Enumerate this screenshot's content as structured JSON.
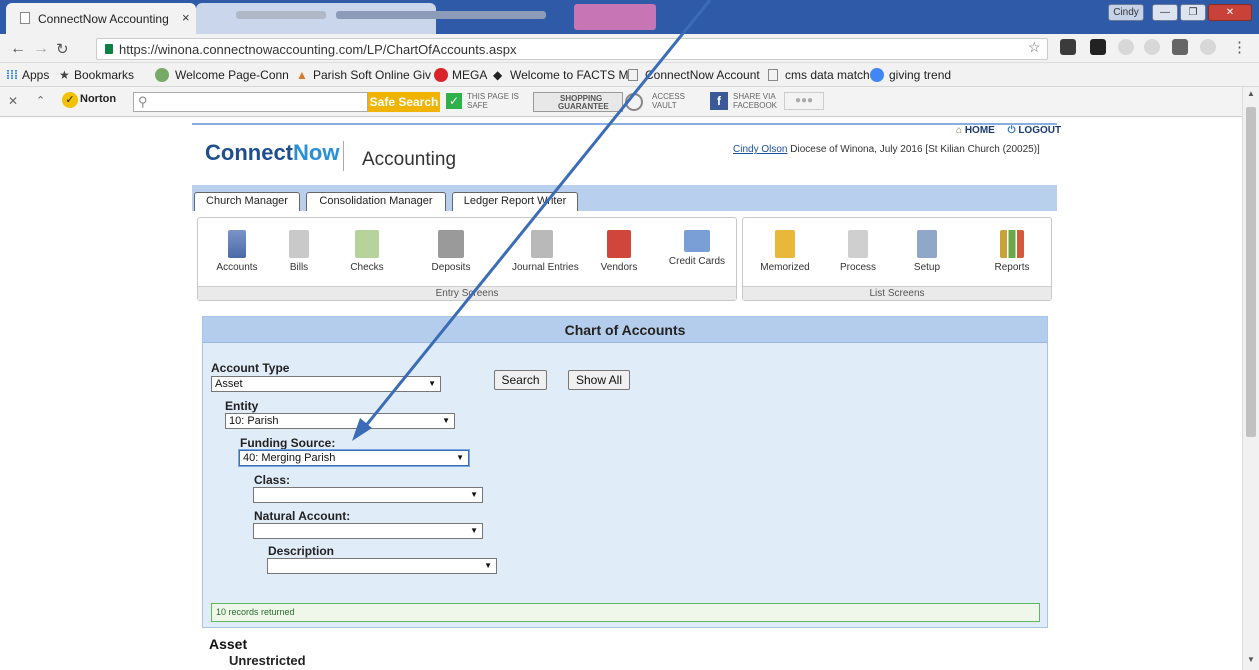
{
  "browser": {
    "tabs": [
      {
        "title": "ConnectNow Accounting"
      }
    ],
    "tab_close": "×",
    "window_user": "Cindy",
    "url": "https://winona.connectnowaccounting.com/LP/ChartOfAccounts.aspx",
    "bookmarks": [
      "Apps",
      "Bookmarks",
      "Welcome Page-Conn",
      "Parish Soft Online Giv",
      "MEGA",
      "Welcome to FACTS M",
      "ConnectNow Account",
      "cms data match",
      "giving trend"
    ],
    "norton": {
      "logo": "Norton",
      "safe_search": "Safe Search",
      "page_safe_line1": "THIS PAGE IS",
      "page_safe_line2": "SAFE",
      "shopping_line1": "SHOPPING",
      "shopping_line2": "GUARANTEE",
      "vault_line1": "ACCESS",
      "vault_line2": "VAULT",
      "share_line1": "SHARE VIA",
      "share_line2": "FACEBOOK"
    }
  },
  "app": {
    "logo_part1": "Connect",
    "logo_part2": "Now",
    "title": "Accounting",
    "home": "HOME",
    "logout": "LOGOUT",
    "user_name": "Cindy Olson",
    "user_context": "Diocese of Winona, July 2016 [St Kilian Church (20025)]",
    "nav_tabs": [
      "Church Manager",
      "Consolidation Manager",
      "Ledger Report Writer"
    ],
    "entry_screens_label": "Entry Screens",
    "list_screens_label": "List Screens",
    "entry_icons": [
      "Accounts",
      "Bills",
      "Checks",
      "Deposits",
      "Journal Entries",
      "Vendors",
      "Credit Cards"
    ],
    "list_icons": [
      "Memorized",
      "Process",
      "Setup",
      "Reports"
    ]
  },
  "chart_of_accounts": {
    "heading": "Chart of Accounts",
    "account_type_label": "Account Type",
    "account_type_value": "Asset",
    "search_button": "Search",
    "show_all_button": "Show All",
    "entity_label": "Entity",
    "entity_value": "10: Parish",
    "funding_label": "Funding Source:",
    "funding_value": "40: Merging Parish",
    "class_label": "Class:",
    "class_value": "",
    "natural_label": "Natural Account:",
    "natural_value": "",
    "description_label": "Description",
    "description_value": "",
    "records_status": "10 records returned",
    "group_heading": "Asset",
    "sub_heading": "Unrestricted"
  },
  "colors": {
    "accent": "#2f5aa8",
    "panel": "#e1ecf9",
    "annotation_arrow": "#3a6cb7"
  }
}
